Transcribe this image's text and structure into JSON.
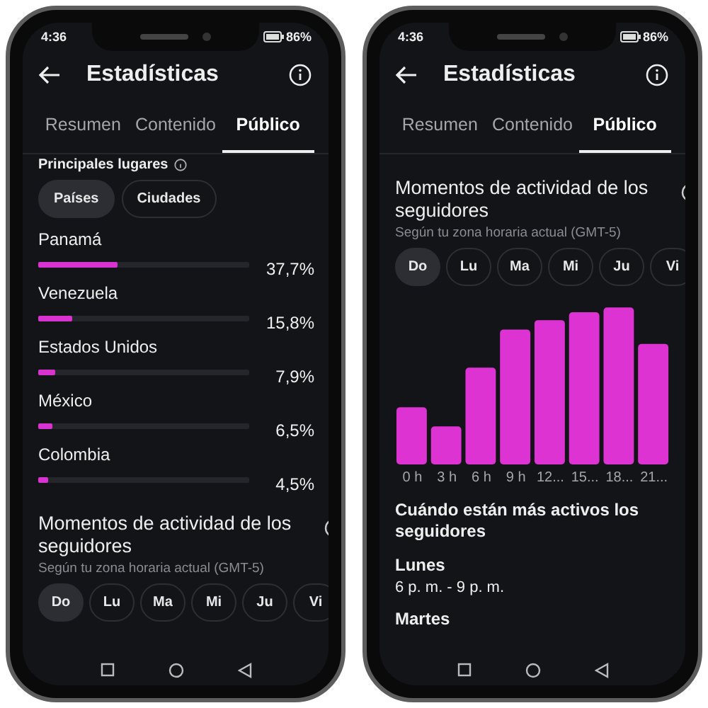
{
  "phones": [
    {
      "status": {
        "time": "4:36",
        "battery": "86%"
      },
      "header": {
        "title": "Estadísticas"
      },
      "tabs": [
        {
          "label": "Resumen",
          "selected": false
        },
        {
          "label": "Contenido",
          "selected": false
        },
        {
          "label": "Público",
          "selected": true
        }
      ],
      "sections": [
        {
          "kind": "places",
          "title": "Principales lugares",
          "filters": [
            {
              "label": "Países",
              "selected": true
            },
            {
              "label": "Ciudades",
              "selected": false
            }
          ],
          "rows": [
            {
              "name": "Panamá",
              "level": 0.377,
              "value": "37,7%"
            },
            {
              "name": "Venezuela",
              "level": 0.158,
              "value": "15,8%"
            },
            {
              "name": "Estados Unidos",
              "level": 0.079,
              "value": "7,9%"
            },
            {
              "name": "México",
              "level": 0.065,
              "value": "6,5%"
            },
            {
              "name": "Colombia",
              "level": 0.045,
              "value": "4,5%"
            }
          ]
        },
        {
          "kind": "activity",
          "title": "Momentos de actividad de los seguidores",
          "subtitle": "Según tu zona horaria actual (GMT-5)",
          "days": [
            {
              "label": "Do",
              "selected": true
            },
            {
              "label": "Lu",
              "selected": false
            },
            {
              "label": "Ma",
              "selected": false
            },
            {
              "label": "Mi",
              "selected": false
            },
            {
              "label": "Ju",
              "selected": false
            },
            {
              "label": "Vi",
              "selected": false
            }
          ]
        }
      ]
    },
    {
      "status": {
        "time": "4:36",
        "battery": "86%"
      },
      "header": {
        "title": "Estadísticas"
      },
      "tabs": [
        {
          "label": "Resumen",
          "selected": false
        },
        {
          "label": "Contenido",
          "selected": false
        },
        {
          "label": "Público",
          "selected": true
        }
      ],
      "sections": [
        {
          "kind": "activity",
          "title": "Momentos de actividad de los seguidores",
          "subtitle": "Según tu zona horaria actual (GMT-5)",
          "days": [
            {
              "label": "Do",
              "selected": true
            },
            {
              "label": "Lu",
              "selected": false
            },
            {
              "label": "Ma",
              "selected": false
            },
            {
              "label": "Mi",
              "selected": false
            },
            {
              "label": "Ju",
              "selected": false
            },
            {
              "label": "Vi",
              "selected": false
            }
          ]
        },
        {
          "kind": "hour_chart",
          "labels": [
            "0 h",
            "3 h",
            "6 h",
            "9 h",
            "12...",
            "15...",
            "18...",
            "21..."
          ]
        },
        {
          "kind": "most_active",
          "title": "Cuándo están más activos los seguidores",
          "entries": [
            {
              "day": "Lunes",
              "time": "6 p. m. - 9 p. m."
            },
            {
              "day": "Martes"
            }
          ]
        }
      ]
    }
  ]
}
